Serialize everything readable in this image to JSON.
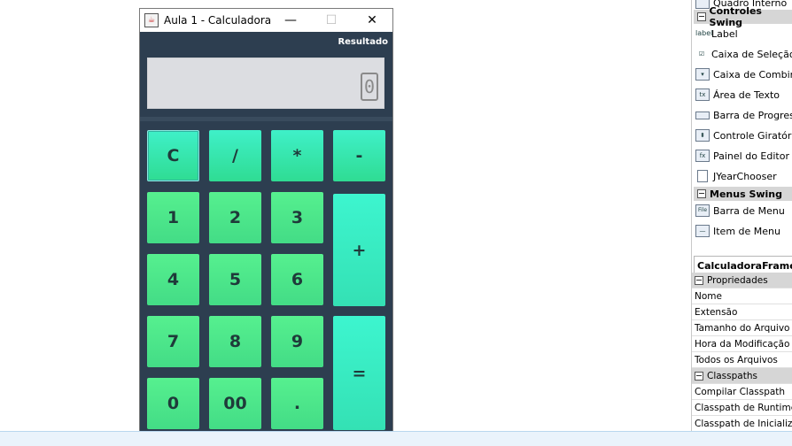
{
  "window": {
    "title": "Aula 1 - Calculadora",
    "minimize": "—",
    "maximize": "☐",
    "close": "✕"
  },
  "calculator": {
    "result_label": "Resultado",
    "display_value": "0",
    "keys": {
      "clear": "C",
      "divide": "/",
      "multiply": "*",
      "minus": "-",
      "plus": "+",
      "equals": "=",
      "one": "1",
      "two": "2",
      "three": "3",
      "four": "4",
      "five": "5",
      "six": "6",
      "seven": "7",
      "eight": "8",
      "nine": "9",
      "zero": "0",
      "double_zero": "00",
      "dot": "."
    }
  },
  "palette": {
    "top_item": "Quadro Interno",
    "swing_controls_header": "Controles Swing",
    "swing_controls": [
      {
        "label": "Label",
        "icon": "label-icon"
      },
      {
        "label": "Caixa de Seleção",
        "icon": "checkbox-icon"
      },
      {
        "label": "Caixa de Combinação",
        "icon": "combobox-icon"
      },
      {
        "label": "Área de Texto",
        "icon": "textarea-icon"
      },
      {
        "label": "Barra de Progresso",
        "icon": "progressbar-icon"
      },
      {
        "label": "Controle Giratório",
        "icon": "spinner-icon"
      },
      {
        "label": "Painel do Editor",
        "icon": "editorpane-icon"
      },
      {
        "label": "JYearChooser",
        "icon": "file-icon"
      }
    ],
    "menus_header": "Menus Swing",
    "menus": [
      {
        "label": "Barra de Menu",
        "icon": "menubar-icon"
      },
      {
        "label": "Item de Menu",
        "icon": "menuitem-icon"
      }
    ]
  },
  "properties": {
    "title": "CalculadoraFrame.java",
    "section_header": "Propriedades",
    "rows": [
      "Nome",
      "Extensão",
      "Tamanho do Arquivo",
      "Hora da Modificação",
      "Todos os Arquivos"
    ],
    "classpaths_header": "Classpaths",
    "classpath_rows": [
      "Compilar Classpath",
      "Classpath de Runtime",
      "Classpath de Inicialização"
    ]
  },
  "colors": {
    "panel_bg": "#2d3e50",
    "key_green": "#43dc86",
    "key_teal": "#3ff0c8",
    "display_bg": "#dcdde1"
  }
}
